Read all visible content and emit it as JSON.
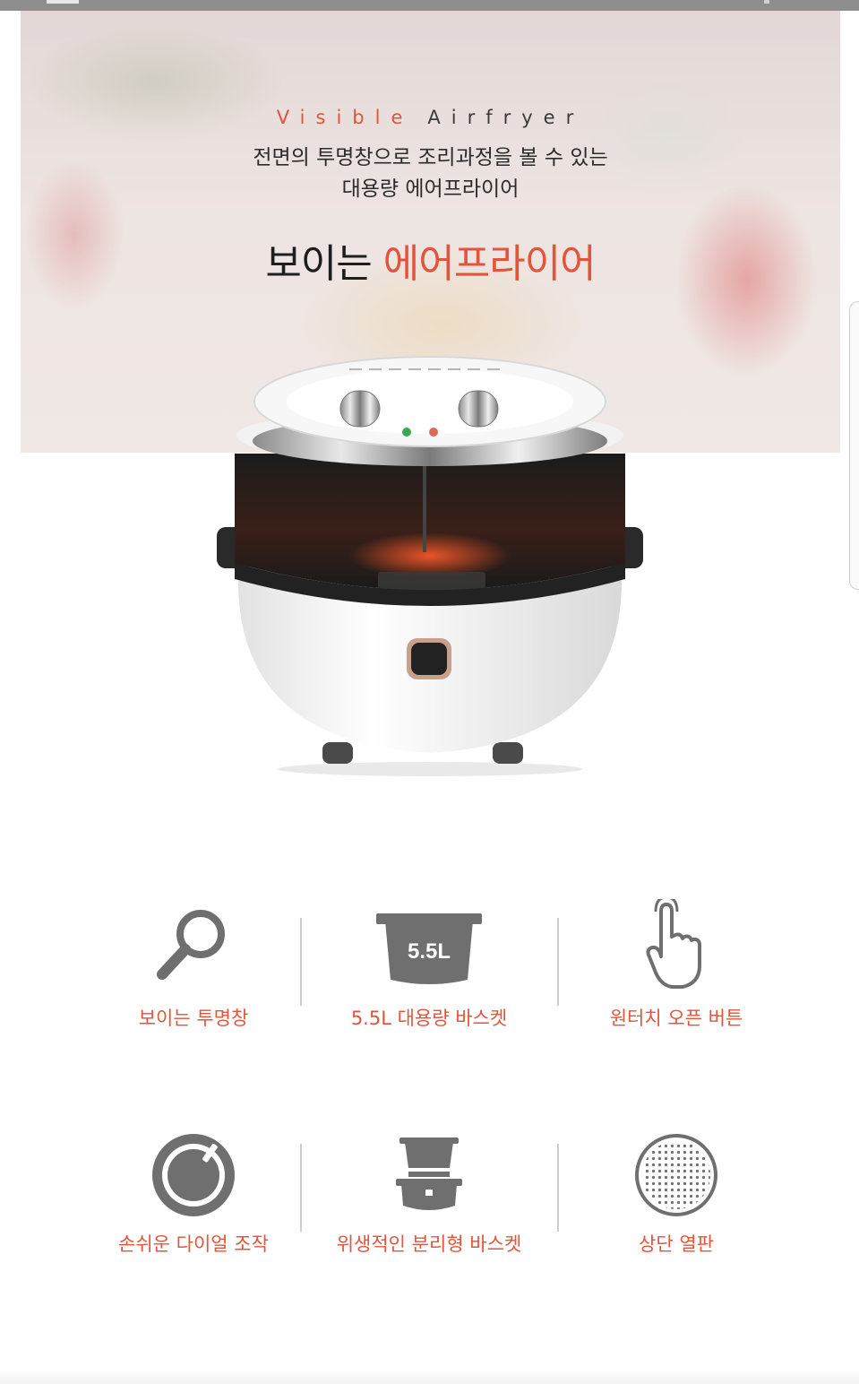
{
  "hero": {
    "eyebrow_accent": "Visible",
    "eyebrow_rest": "Airfryer",
    "subtitle_line1": "전면의 투명창으로 조리과정을 볼 수 있는",
    "subtitle_line2": "대용량 에어프라이어",
    "headline_plain": "보이는",
    "headline_accent": "에어프라이어"
  },
  "features": [
    {
      "icon": "magnifier-icon",
      "label": "보이는 투명창"
    },
    {
      "icon": "basket-icon",
      "label": "5.5L 대용량 바스켓",
      "icon_text": "5.5L"
    },
    {
      "icon": "touch-hand-icon",
      "label": "원터치 오픈 버튼"
    },
    {
      "icon": "dial-icon",
      "label": "손쉬운 다이얼 조작"
    },
    {
      "icon": "separable-basket-icon",
      "label": "위생적인 분리형 바스켓"
    },
    {
      "icon": "perforated-plate-icon",
      "label": "상단 열판"
    }
  ],
  "colors": {
    "accent": "#e2543b",
    "icon_gray": "#6f6f6f",
    "text_dark": "#1e1e1e"
  }
}
